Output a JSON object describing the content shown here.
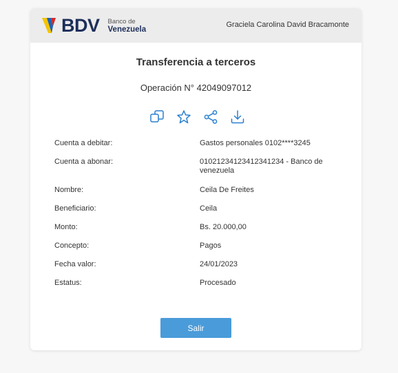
{
  "header": {
    "logo_text": "BDV",
    "logo_sub1": "Banco de",
    "logo_sub2": "Venezuela",
    "user_name": "Graciela Carolina David Bracamonte"
  },
  "main": {
    "title": "Transferencia a terceros",
    "operation": "Operación N° 42049097012",
    "details": [
      {
        "label": "Cuenta a debitar:",
        "value": "Gastos personales 0102****3245"
      },
      {
        "label": "Cuenta a abonar:",
        "value": "01021234123412341234 - Banco de venezuela"
      },
      {
        "label": "Nombre:",
        "value": "Ceila De Freites"
      },
      {
        "label": "Beneficiario:",
        "value": "Ceila"
      },
      {
        "label": "Monto:",
        "value": "Bs. 20.000,00"
      },
      {
        "label": "Concepto:",
        "value": "Pagos"
      },
      {
        "label": "Fecha valor:",
        "value": "24/01/2023"
      },
      {
        "label": "Estatus:",
        "value": "Procesado"
      }
    ],
    "exit_label": "Salir"
  },
  "icons": [
    "copy-icon",
    "star-icon",
    "share-icon",
    "download-icon"
  ],
  "colors": {
    "accent": "#4a9bd9",
    "brand_navy": "#1d2e5a",
    "brand_yellow": "#f5c400",
    "brand_blue": "#1e63b5",
    "brand_red": "#d62828",
    "header_bg": "#ececec"
  }
}
